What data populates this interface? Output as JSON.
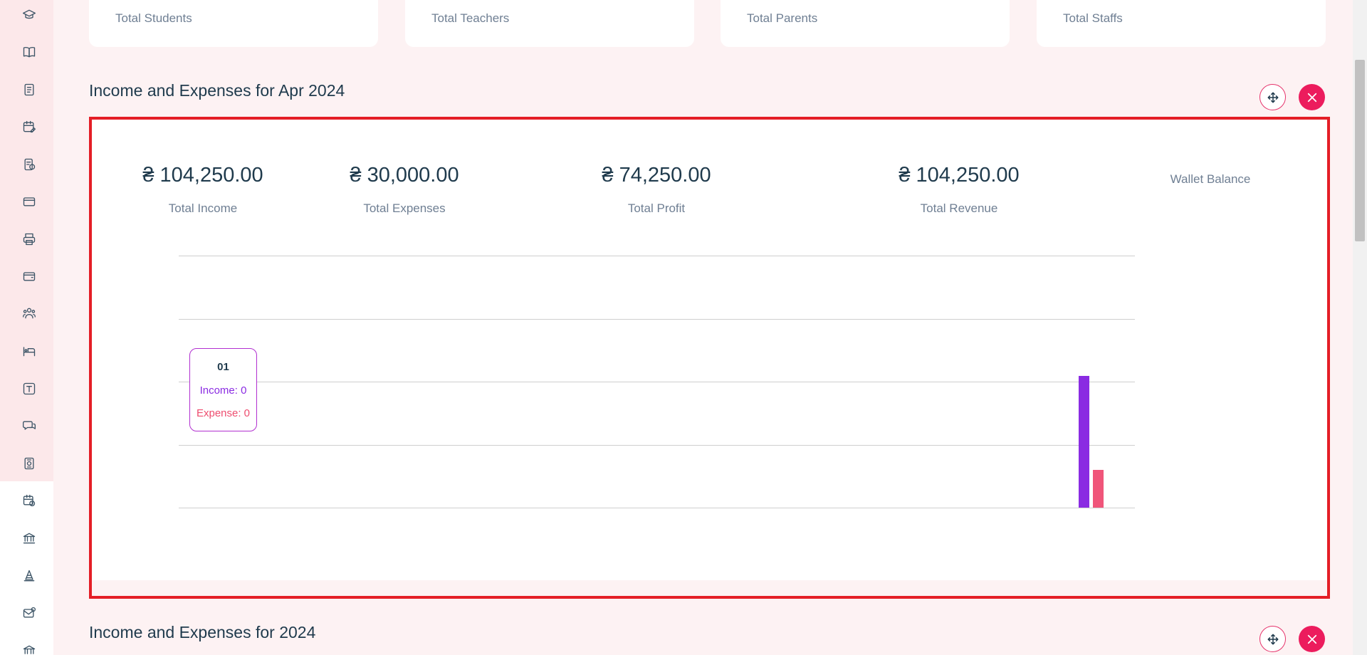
{
  "stat_cards": [
    "Total Students",
    "Total Teachers",
    "Total Parents",
    "Total Staffs"
  ],
  "section_month": {
    "title": "Income and Expenses for Apr 2024",
    "kpis": [
      {
        "value": "₴ 104,250.00",
        "label": "Total Income"
      },
      {
        "value": "₴ 30,000.00",
        "label": "Total Expenses"
      },
      {
        "value": "₴ 74,250.00",
        "label": "Total Profit"
      },
      {
        "value": "₴ 104,250.00",
        "label": "Total Revenue"
      },
      {
        "value": "",
        "label": "Wallet Balance"
      }
    ],
    "tooltip": {
      "title": "01",
      "income": "Income: 0",
      "expense": "Expense: 0"
    }
  },
  "section_year": {
    "title": "Income and Expenses for 2024"
  },
  "colors": {
    "income": "#8a2be2",
    "expense": "#f0557a",
    "accent": "#ec1c5d",
    "highlight_border": "#e41e26"
  },
  "sidebar_icons": [
    "graduation-cap-icon",
    "book-icon",
    "document-icon",
    "calendar-edit-icon",
    "fees-icon",
    "card-icon",
    "printer-icon",
    "wallet-icon",
    "users-icon",
    "bed-icon",
    "text-icon",
    "chat-icon",
    "invoice-icon",
    "calendar-clock-icon",
    "bank-icon",
    "cone-icon",
    "mail-check-icon",
    "bank-icon-2"
  ],
  "chart_data": {
    "type": "bar",
    "series": [
      {
        "name": "Income",
        "values": [
          104250
        ]
      },
      {
        "name": "Expense",
        "values": [
          30000
        ]
      }
    ],
    "ylim": [
      0,
      200000
    ],
    "grid": true
  }
}
